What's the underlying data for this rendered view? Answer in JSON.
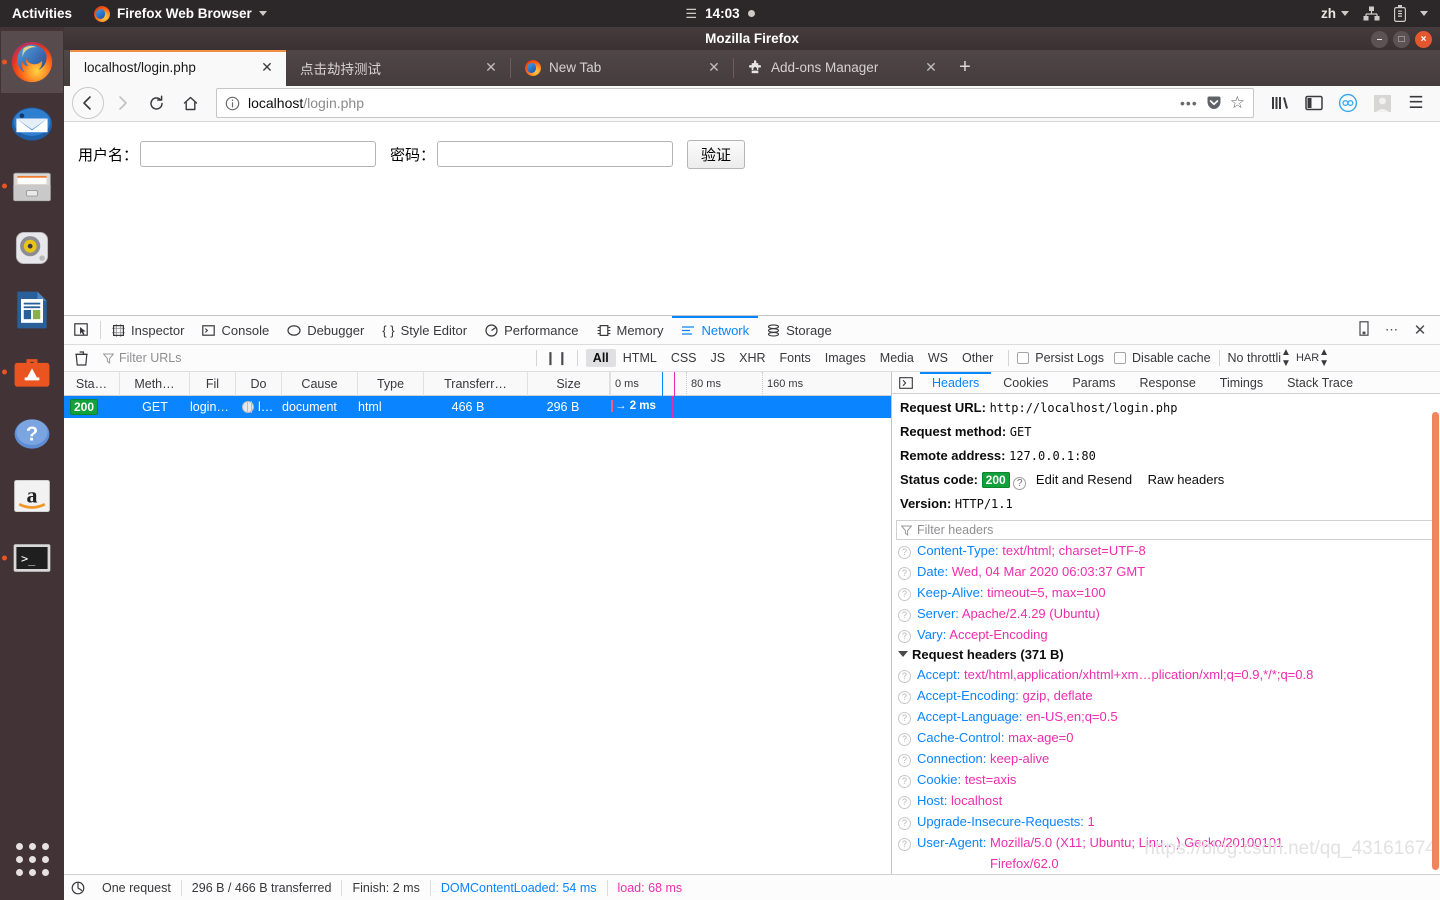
{
  "topbar": {
    "activities": "Activities",
    "app_menu": "Firefox Web Browser",
    "clock": "14:03",
    "lang": "zh",
    "icons": [
      "hamburger-menu-icon",
      "network-icon",
      "battery-icon",
      "caret-down-icon"
    ]
  },
  "dock": {
    "items": [
      {
        "name": "firefox",
        "label": "Firefox Web Browser",
        "active": true,
        "running": true
      },
      {
        "name": "thunderbird",
        "label": "Thunderbird Mail",
        "active": false,
        "running": false
      },
      {
        "name": "files",
        "label": "Files",
        "active": false,
        "running": true
      },
      {
        "name": "rhythmbox",
        "label": "Rhythmbox",
        "active": false,
        "running": false
      },
      {
        "name": "libreoffice-writer",
        "label": "LibreOffice Writer",
        "active": false,
        "running": false
      },
      {
        "name": "ubuntu-software",
        "label": "Ubuntu Software",
        "active": false,
        "running": true
      },
      {
        "name": "help",
        "label": "Help",
        "active": false,
        "running": false
      },
      {
        "name": "amazon",
        "label": "Amazon",
        "active": false,
        "running": false
      },
      {
        "name": "terminal",
        "label": "Terminal",
        "active": false,
        "running": true
      }
    ],
    "show_apps_label": "Show Applications"
  },
  "window": {
    "title": "Mozilla Firefox",
    "minimize": "–",
    "maximize": "□",
    "close": "×"
  },
  "tabs": [
    {
      "label": "localhost/login.php",
      "selected": true,
      "icon": "none",
      "close": "✕"
    },
    {
      "label": "点击劫持测试",
      "selected": false,
      "icon": "none",
      "close": "✕"
    },
    {
      "label": "New Tab",
      "selected": false,
      "icon": "firefox-icon",
      "close": "✕"
    },
    {
      "label": "Add-ons Manager",
      "selected": false,
      "icon": "puzzle-icon",
      "close": "✕"
    }
  ],
  "new_tab_button": "+",
  "navbar": {
    "back": "←",
    "forward": "→",
    "reload": "↻",
    "home": "⌂",
    "url_scheme": "localhost",
    "url_path": "/login.php",
    "url_full": "localhost/login.php",
    "page_actions": "•••",
    "pocket": "pocket-icon",
    "bookmark_star": "☆",
    "library": "library-icon",
    "sidebar": "sidebar-icon",
    "sync": "sync-icon",
    "account": "account-avatar-icon",
    "menu": "☰"
  },
  "page": {
    "username_label": "用户名：",
    "username_value": "",
    "password_label": "密码：",
    "password_value": "",
    "submit_label": "验证"
  },
  "devtools": {
    "picker_icon": "element-picker-icon",
    "tabs": [
      {
        "label": "Inspector",
        "icon": "inspector-icon",
        "active": false
      },
      {
        "label": "Console",
        "icon": "console-icon",
        "active": false
      },
      {
        "label": "Debugger",
        "icon": "debugger-icon",
        "active": false
      },
      {
        "label": "Style Editor",
        "icon": "style-editor-icon",
        "active": false
      },
      {
        "label": "Performance",
        "icon": "performance-icon",
        "active": false
      },
      {
        "label": "Memory",
        "icon": "memory-icon",
        "active": false
      },
      {
        "label": "Network",
        "icon": "network-icon",
        "active": true
      },
      {
        "label": "Storage",
        "icon": "storage-icon",
        "active": false
      }
    ],
    "right_icons": [
      "responsive-design-icon",
      "meatball-menu-icon",
      "close-devtools-icon"
    ],
    "network_toolbar": {
      "clear_icon": "trash-icon",
      "filter_placeholder": "Filter URLs",
      "pause_icon": "pause-icon",
      "filters": [
        {
          "label": "All",
          "selected": true
        },
        {
          "label": "HTML",
          "selected": false
        },
        {
          "label": "CSS",
          "selected": false
        },
        {
          "label": "JS",
          "selected": false
        },
        {
          "label": "XHR",
          "selected": false
        },
        {
          "label": "Fonts",
          "selected": false
        },
        {
          "label": "Images",
          "selected": false
        },
        {
          "label": "Media",
          "selected": false
        },
        {
          "label": "WS",
          "selected": false
        },
        {
          "label": "Other",
          "selected": false
        }
      ],
      "persist_logs": "Persist Logs",
      "persist_logs_checked": false,
      "disable_cache": "Disable cache",
      "disable_cache_checked": false,
      "throttling": "No throttli",
      "har": "HAR"
    },
    "columns": [
      "Sta…",
      "Meth…",
      "Fil",
      "Do",
      "Cause",
      "Type",
      "Transferr…",
      "Size"
    ],
    "timeline_ticks": [
      "0 ms",
      "80 ms",
      "160 ms"
    ],
    "rows": [
      {
        "status": "200",
        "method": "GET",
        "file": "login…",
        "domain": "l…",
        "domain_icon": "globe-icon",
        "cause": "document",
        "type": "html",
        "transferred": "466 B",
        "size": "296 B",
        "time": "2 ms",
        "selected": true
      }
    ],
    "details": {
      "tabs": [
        {
          "label": "Headers",
          "active": true
        },
        {
          "label": "Cookies",
          "active": false
        },
        {
          "label": "Params",
          "active": false
        },
        {
          "label": "Response",
          "active": false
        },
        {
          "label": "Timings",
          "active": false
        },
        {
          "label": "Stack Trace",
          "active": false
        }
      ],
      "back_icon": "panel-toggle-icon",
      "summary": [
        {
          "label": "Request URL:",
          "value": "http://localhost/login.php"
        },
        {
          "label": "Request method:",
          "value": "GET"
        },
        {
          "label": "Remote address:",
          "value": "127.0.0.1:80"
        }
      ],
      "status_label": "Status code:",
      "status_code": "200",
      "status_help": "?",
      "edit_resend": "Edit and Resend",
      "raw_headers": "Raw headers",
      "version_label": "Version:",
      "version_value": "HTTP/1.1",
      "filter_headers_placeholder": "Filter headers",
      "response_headers": [
        {
          "name": "Content-Type:",
          "value": "text/html; charset=UTF-8"
        },
        {
          "name": "Date:",
          "value": "Wed, 04 Mar 2020 06:03:37 GMT"
        },
        {
          "name": "Keep-Alive:",
          "value": "timeout=5, max=100"
        },
        {
          "name": "Server:",
          "value": "Apache/2.4.29 (Ubuntu)"
        },
        {
          "name": "Vary:",
          "value": "Accept-Encoding"
        }
      ],
      "request_headers_title": "Request headers (371 B)",
      "request_headers": [
        {
          "name": "Accept:",
          "value": "text/html,application/xhtml+xm…plication/xml;q=0.9,*/*;q=0.8"
        },
        {
          "name": "Accept-Encoding:",
          "value": "gzip, deflate"
        },
        {
          "name": "Accept-Language:",
          "value": "en-US,en;q=0.5"
        },
        {
          "name": "Cache-Control:",
          "value": "max-age=0"
        },
        {
          "name": "Connection:",
          "value": "keep-alive"
        },
        {
          "name": "Cookie:",
          "value": "test=axis"
        },
        {
          "name": "Host:",
          "value": "localhost"
        },
        {
          "name": "Upgrade-Insecure-Requests:",
          "value": "1"
        },
        {
          "name": "User-Agent:",
          "value": "Mozilla/5.0 (X11; Ubuntu; Linu…) Gecko/20100101"
        }
      ],
      "user_agent_wrap": "Firefox/62.0"
    },
    "status_bar": {
      "network_icon": "network-status-icon",
      "requests": "One request",
      "transferred": "296 B / 466 B transferred",
      "finish": "Finish: 2 ms",
      "dom_content_loaded": "DOMContentLoaded: 54 ms",
      "load": "load: 68 ms"
    }
  },
  "watermark": "https://blog.csdn.net/qq_43161674",
  "colors": {
    "accent_blue": "#0a84ff",
    "status_green": "#12a13a",
    "header_value_pink": "#ed2dad",
    "ubuntu_orange": "#e95420",
    "selected_row": "#0a84ff"
  }
}
